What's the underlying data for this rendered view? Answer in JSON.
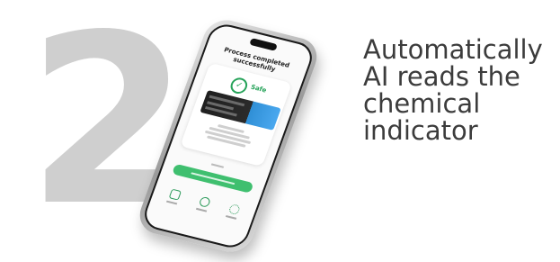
{
  "step": {
    "number": "2"
  },
  "caption": {
    "lines": [
      "Automatically",
      "AI reads the",
      "chemical",
      "indicator"
    ]
  },
  "phone": {
    "screen_title": "Process completed successfully",
    "status": "Safe",
    "icons": [
      "check-icon",
      "home-icon",
      "history-icon",
      "settings-icon"
    ]
  },
  "colors": {
    "step_number": "#cfcfcf",
    "caption_text": "#3c3c3c",
    "accent_green": "#3fbf6f",
    "indicator_blue": "#2f8fd6"
  }
}
